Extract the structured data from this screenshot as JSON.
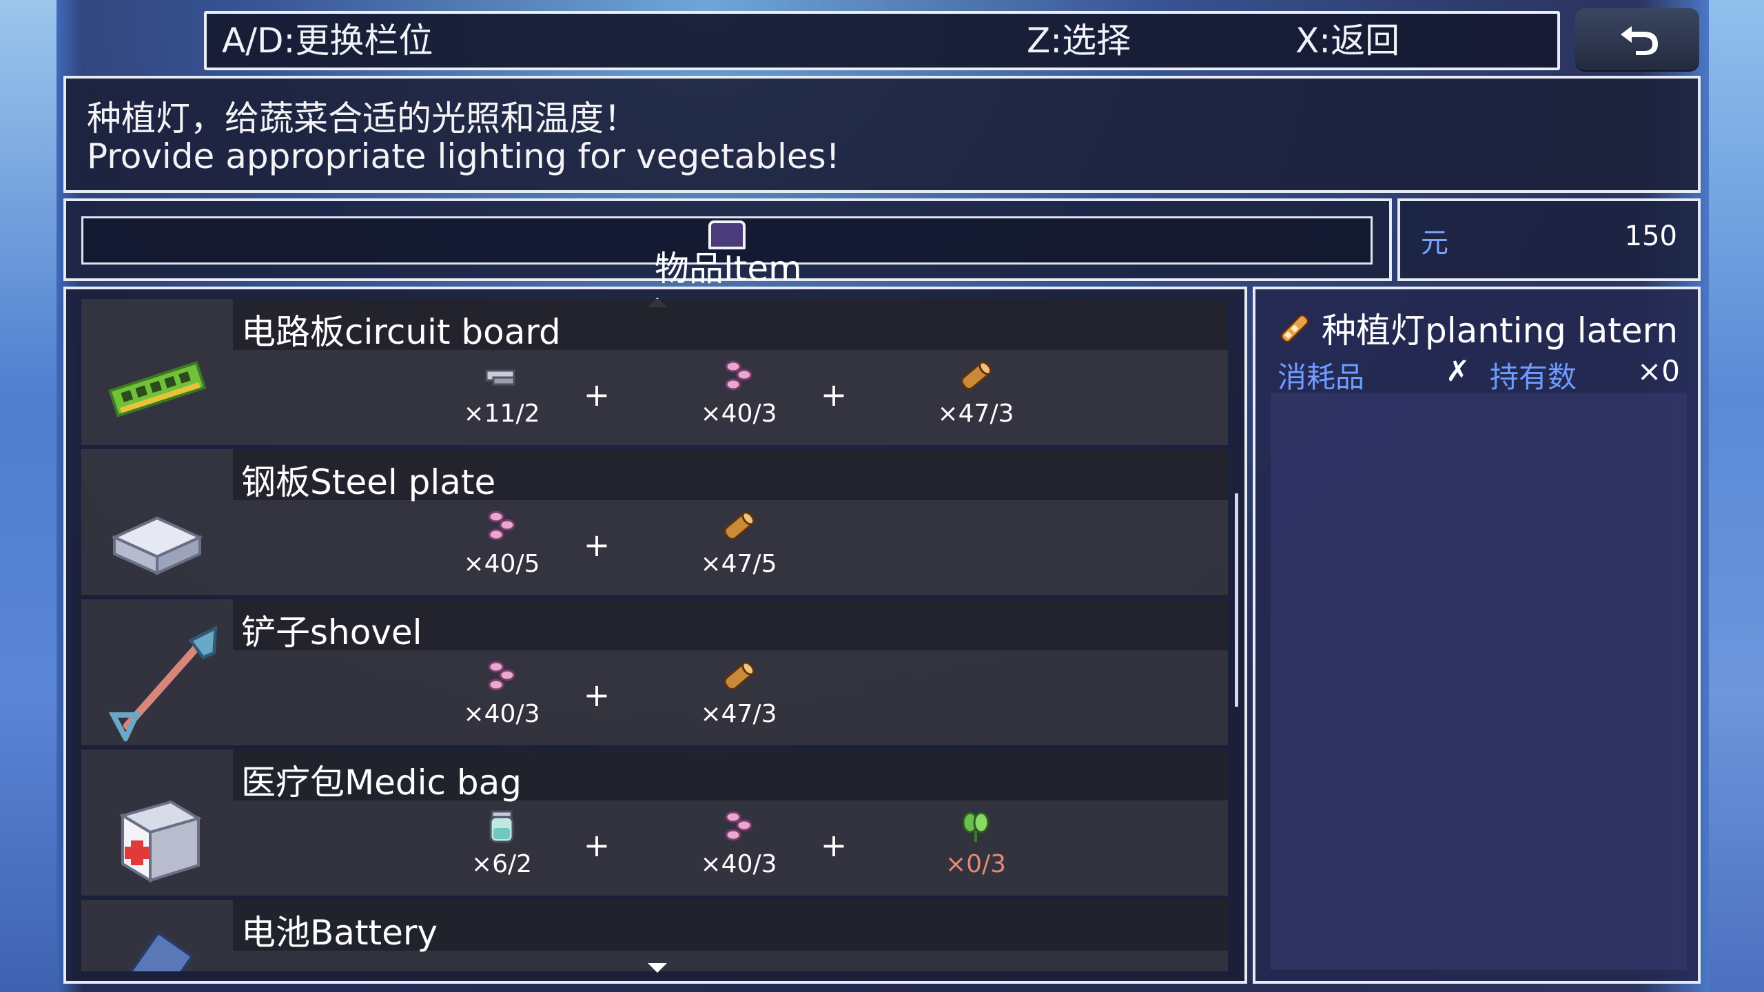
{
  "hints": {
    "switch": "A/D:更换栏位",
    "select": "Z:选择",
    "back": "X:返回"
  },
  "description": {
    "line1": "种植灯，给蔬菜合适的光照和温度！",
    "line2": "Provide appropriate lighting for vegetables!"
  },
  "category": {
    "label": "物品Item"
  },
  "money": {
    "unit": "元",
    "value": "150"
  },
  "recipes": [
    {
      "name": "电路板circuit board",
      "ingredients": [
        {
          "icon": "scrap-metal-icon",
          "qty": "×11/2"
        },
        {
          "icon": "ore-chunk-icon",
          "qty": "×40/3"
        },
        {
          "icon": "wood-log-icon",
          "qty": "×47/3"
        }
      ]
    },
    {
      "name": "钢板Steel plate",
      "ingredients": [
        {
          "icon": "ore-chunk-icon",
          "qty": "×40/5"
        },
        {
          "icon": "wood-log-icon",
          "qty": "×47/5"
        }
      ]
    },
    {
      "name": "铲子shovel",
      "ingredients": [
        {
          "icon": "ore-chunk-icon",
          "qty": "×40/3"
        },
        {
          "icon": "wood-log-icon",
          "qty": "×47/3"
        }
      ]
    },
    {
      "name": "医疗包Medic bag",
      "ingredients": [
        {
          "icon": "water-jar-icon",
          "qty": "×6/2"
        },
        {
          "icon": "ore-chunk-icon",
          "qty": "×40/3"
        },
        {
          "icon": "herb-leaf-icon",
          "qty": "×0/3"
        }
      ]
    },
    {
      "name": "电池Battery",
      "ingredients": []
    }
  ],
  "detail": {
    "title": "种植灯planting latern",
    "type_label": "消耗品",
    "type_value": "✗",
    "owned_label": "持有数",
    "owned_value": "×0"
  },
  "colors": {
    "accent_blue": "#6f9cff",
    "insufficient": "#e28a72",
    "border": "#e6ebf5"
  }
}
